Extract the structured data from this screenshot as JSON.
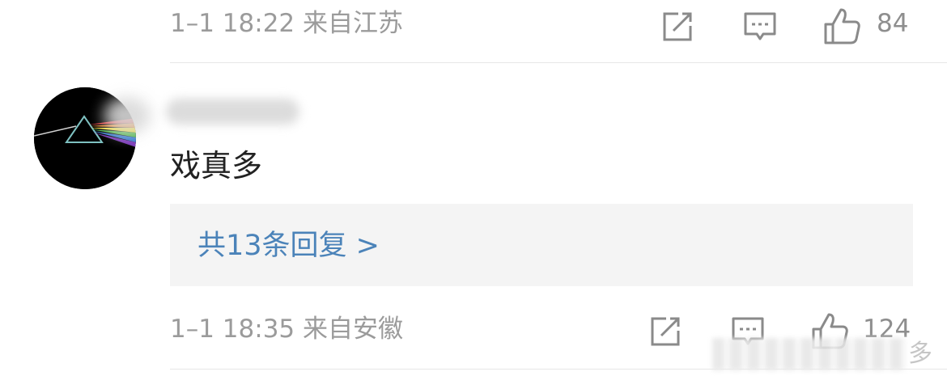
{
  "comment_top": {
    "meta": "1–1 18:22 来自江苏",
    "like_count": "84"
  },
  "comment_main": {
    "username": "",
    "text": "戏真多",
    "reply_link": "共13条回复 >",
    "meta": "1–1 18:35 来自安徽",
    "like_count": "124"
  },
  "footer": {
    "more_label": "多"
  },
  "icons": {
    "share": "share-edit-icon",
    "comment": "comment-icon",
    "like": "thumbs-up-icon"
  },
  "colors": {
    "meta_text": "#9b9b9b",
    "reply_link": "#4b83b9",
    "reply_bg": "#f4f4f4"
  }
}
